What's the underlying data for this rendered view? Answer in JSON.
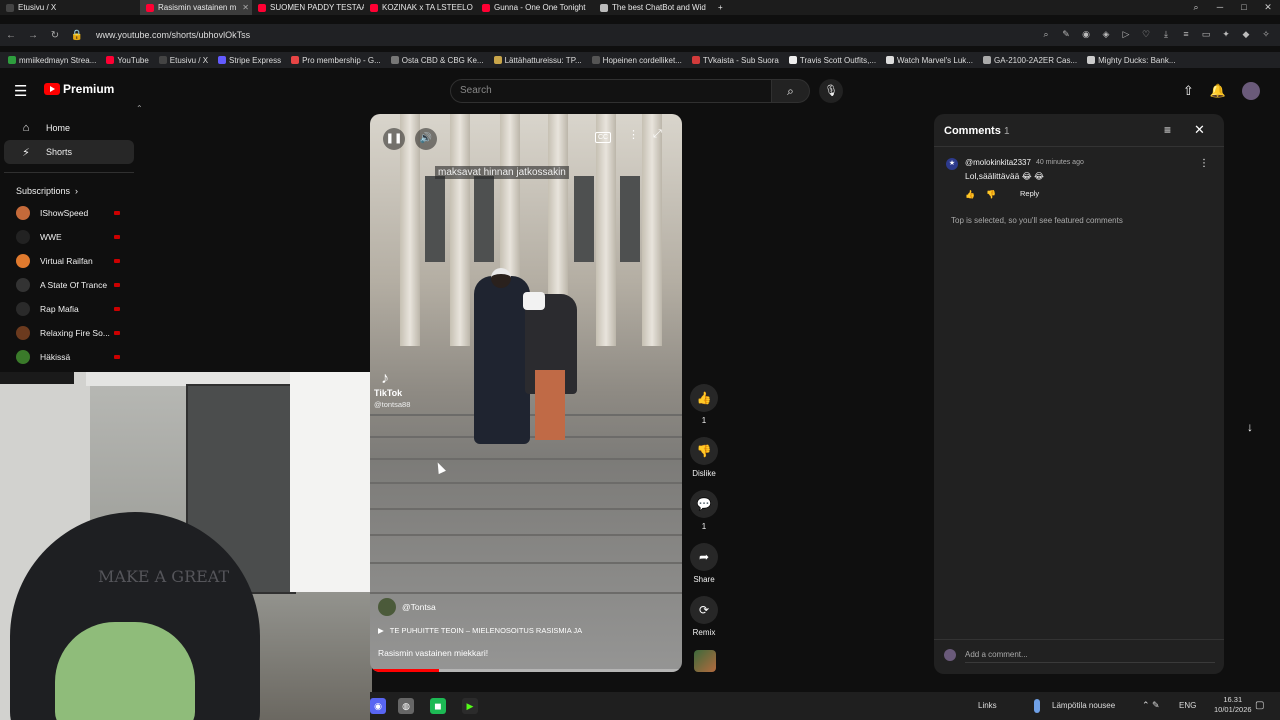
{
  "browser": {
    "tabs": [
      {
        "label": "Etusivu / X",
        "color": "#444444"
      },
      {
        "label": "Rasismin vastainen m",
        "color": "#ff0033"
      },
      {
        "label": "SUOMEN PADDY TESTAA",
        "color": "#ff0033"
      },
      {
        "label": "KOZINAK x TA LSTEELO",
        "color": "#ff0033"
      },
      {
        "label": "Gunna - One One Tonight",
        "color": "#ff0033"
      },
      {
        "label": "The best ChatBot and Wid",
        "color": "#bbbbbb"
      }
    ],
    "new_tab": "+",
    "url": "www.youtube.com/shorts/ubhovlOkTss",
    "bookmarks": [
      {
        "label": "mmiikedmayn Strea...",
        "color": "#2e9e3e"
      },
      {
        "label": "YouTube",
        "color": "#ff0033"
      },
      {
        "label": "Etusivu / X",
        "color": "#444444"
      },
      {
        "label": "Stripe Express",
        "color": "#635bff"
      },
      {
        "label": "Pro membership - G...",
        "color": "#e84545"
      },
      {
        "label": "Osta CBD & CBG Ke...",
        "color": "#777777"
      },
      {
        "label": "Lättähattureissu: TP...",
        "color": "#c8a54a"
      },
      {
        "label": "Hopeinen cordelliket...",
        "color": "#555555"
      },
      {
        "label": "TVkaista - Sub Suora",
        "color": "#d23b3b"
      },
      {
        "label": "Travis Scott Outfits,...",
        "color": "#eeeeee"
      },
      {
        "label": "Watch Marvel's Luk...",
        "color": "#dddddd"
      },
      {
        "label": "GA-2100-2A2ER Cas...",
        "color": "#aaaaaa"
      },
      {
        "label": "Mighty Ducks: Bank...",
        "color": "#cccccc"
      }
    ]
  },
  "header": {
    "logo_text": "Premium",
    "search_placeholder": "Search"
  },
  "sidebar": {
    "items": [
      {
        "label": "Home",
        "icon": "home-icon"
      },
      {
        "label": "Shorts",
        "icon": "shorts-icon"
      }
    ],
    "subscriptions_label": "Subscriptions",
    "subscriptions": [
      {
        "name": "IShowSpeed",
        "color": "#c46a3a"
      },
      {
        "name": "WWE",
        "color": "#222222"
      },
      {
        "name": "Virtual Railfan",
        "color": "#e07a2e"
      },
      {
        "name": "A State Of Trance",
        "color": "#333333"
      },
      {
        "name": "Rap Mafia",
        "color": "#2a2a2a"
      },
      {
        "name": "Relaxing Fire So...",
        "color": "#6b3a1e"
      },
      {
        "name": "Häkissä",
        "color": "#3a7a2a"
      }
    ]
  },
  "player": {
    "caption": "maksavat hinnan jatkossakin",
    "tiktok_name": "TikTok",
    "tiktok_handle": "@tontsa88",
    "channel": "@Tontsa",
    "music": "TE PUHUITTE TEOIN – MIELENOSOITUS RASISMIA JA",
    "title": "Rasismin vastainen miekkari!",
    "progress": 0.22
  },
  "actions": {
    "like_count": "1",
    "dislike_label": "Dislike",
    "comment_count": "1",
    "share_label": "Share",
    "remix_label": "Remix"
  },
  "comments": {
    "title": "Comments",
    "count": "1",
    "items": [
      {
        "author": "@molokinkita2337",
        "time": "40 minutes ago",
        "text": "Lol,säälittävää 😂 😂",
        "reply_label": "Reply"
      }
    ],
    "notice": "Top is selected, so you'll see featured comments",
    "input_placeholder": "Add a comment..."
  },
  "taskbar": {
    "links": "Links",
    "weather": "Lämpötila nousee",
    "lang": "ENG",
    "time": "16.31",
    "date": "10/01/2026"
  },
  "webcam": {
    "cap_text": "MAKE A GREAT"
  }
}
